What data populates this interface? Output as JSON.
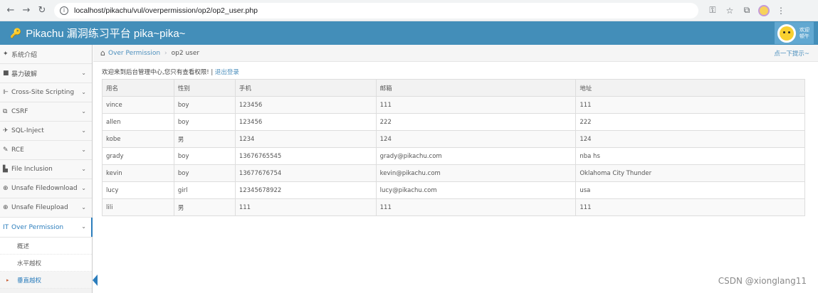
{
  "browser": {
    "url": "localhost/pikachu/vul/overpermission/op2/op2_user.php"
  },
  "header": {
    "title": "Pikachu 漏洞练习平台 pika~pika~",
    "welcome_line1": "欢迎",
    "welcome_line2": "顿午"
  },
  "sidebar": {
    "items": [
      {
        "label": "系统介绍",
        "icon": "tags-icon"
      },
      {
        "label": "暴力破解",
        "icon": "lock-icon"
      },
      {
        "label": "Cross-Site Scripting",
        "icon": "xss-icon"
      },
      {
        "label": "CSRF",
        "icon": "share-icon"
      },
      {
        "label": "SQL-Inject",
        "icon": "plane-icon"
      },
      {
        "label": "RCE",
        "icon": "pencil-icon"
      },
      {
        "label": "File Inclusion",
        "icon": "file-icon"
      },
      {
        "label": "Unsafe Filedownload",
        "icon": "download-icon"
      },
      {
        "label": "Unsafe Fileupload",
        "icon": "upload-icon"
      },
      {
        "label": "Over Permission",
        "icon": "text-height-icon"
      }
    ],
    "subitems": [
      "概述",
      "水平越权",
      "垂直越权"
    ]
  },
  "breadcrumbs": {
    "parent": "Over Permission",
    "current": "op2 user",
    "tip": "点一下提示~"
  },
  "main": {
    "welcome": "欢迎来到后台管理中心,您只有查看权限! | ",
    "logout": "退出登录",
    "columns": [
      "用名",
      "性别",
      "手机",
      "邮箱",
      "地址"
    ],
    "rows": [
      [
        "vince",
        "boy",
        "123456",
        "111",
        "111"
      ],
      [
        "allen",
        "boy",
        "123456",
        "222",
        "222"
      ],
      [
        "kobe",
        "男",
        "1234",
        "124",
        "124"
      ],
      [
        "grady",
        "boy",
        "13676765545",
        "grady@pikachu.com",
        "nba hs"
      ],
      [
        "kevin",
        "boy",
        "13677676754",
        "kevin@pikachu.com",
        "Oklahoma City Thunder"
      ],
      [
        "lucy",
        "girl",
        "12345678922",
        "lucy@pikachu.com",
        "usa"
      ],
      [
        "lili",
        "男",
        "111",
        "111",
        "111"
      ]
    ]
  },
  "watermark": "CSDN @xionglang11"
}
